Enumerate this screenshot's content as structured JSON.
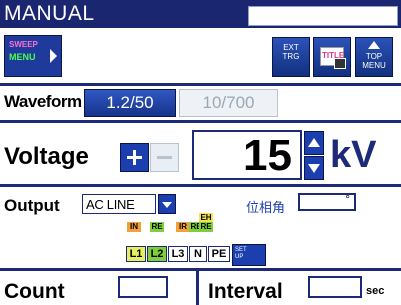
{
  "header": {
    "title": "MANUAL",
    "field_value": ""
  },
  "menu": {
    "sweep_top": "SWEEP",
    "sweep_bottom": "MENU",
    "ext_trig_line1": "EXT",
    "ext_trig_line2": "TRG",
    "title_badge": "TITLE",
    "top_menu_line1": "TOP",
    "top_menu_line2": "MENU"
  },
  "waveform": {
    "label": "Waveform",
    "options": [
      "1.2/50",
      "10/700"
    ],
    "selected": "1.2/50"
  },
  "voltage": {
    "label": "Voltage",
    "value": "15",
    "unit": "kV"
  },
  "output": {
    "label": "Output",
    "selected": "AC LINE",
    "phase_label": "位相角",
    "phase_value": "",
    "phase_unit": "°",
    "tags": [
      "IN",
      "RE",
      "IR",
      "RE",
      "EH",
      "RE"
    ],
    "connectors": [
      "L1",
      "L2",
      "L3",
      "N",
      "PE"
    ],
    "setup_line1": "SET",
    "setup_line2": "UP"
  },
  "count": {
    "label": "Count",
    "value": ""
  },
  "interval": {
    "label": "Interval",
    "value": "",
    "unit": "sec"
  },
  "colors": {
    "accent": "#1c2a78",
    "button": "#1c3fb0",
    "title_bar": "#1b2670"
  }
}
